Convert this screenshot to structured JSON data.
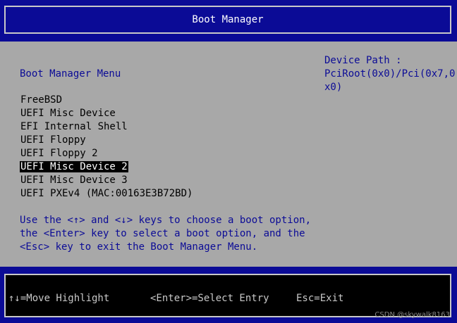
{
  "header": {
    "title": "Boot Manager"
  },
  "main": {
    "menu_title": "Boot Manager Menu",
    "device_path": {
      "label": "Device Path :",
      "line1": "PciRoot(0x0)/Pci(0x7,0",
      "line2": "x0)"
    },
    "boot_options": [
      {
        "label": "FreeBSD",
        "selected": false
      },
      {
        "label": "UEFI Misc Device",
        "selected": false
      },
      {
        "label": "EFI Internal Shell",
        "selected": false
      },
      {
        "label": "UEFI Floppy",
        "selected": false
      },
      {
        "label": "UEFI Floppy 2",
        "selected": false
      },
      {
        "label": "UEFI Misc Device 2",
        "selected": true
      },
      {
        "label": "UEFI Misc Device 3",
        "selected": false
      },
      {
        "label": "UEFI PXEv4 (MAC:00163E3B72BD)",
        "selected": false
      }
    ],
    "help": {
      "line1": "Use the <↑> and <↓> keys to choose a boot option,",
      "line2": "the <Enter> key to select a boot option, and the",
      "line3": "<Esc> key to exit the Boot Manager Menu."
    }
  },
  "footer": {
    "move": "↑↓=Move Highlight",
    "select": "<Enter>=Select Entry",
    "exit": "Esc=Exit"
  },
  "watermark": "CSDN @skywalk8163",
  "colors": {
    "header_bg": "#0b0b96",
    "main_bg": "#a8a8a8",
    "text_blue": "#0b0b96",
    "selection_bg": "#000000",
    "selection_fg": "#ffffff",
    "frame": "#c8c8c8"
  }
}
